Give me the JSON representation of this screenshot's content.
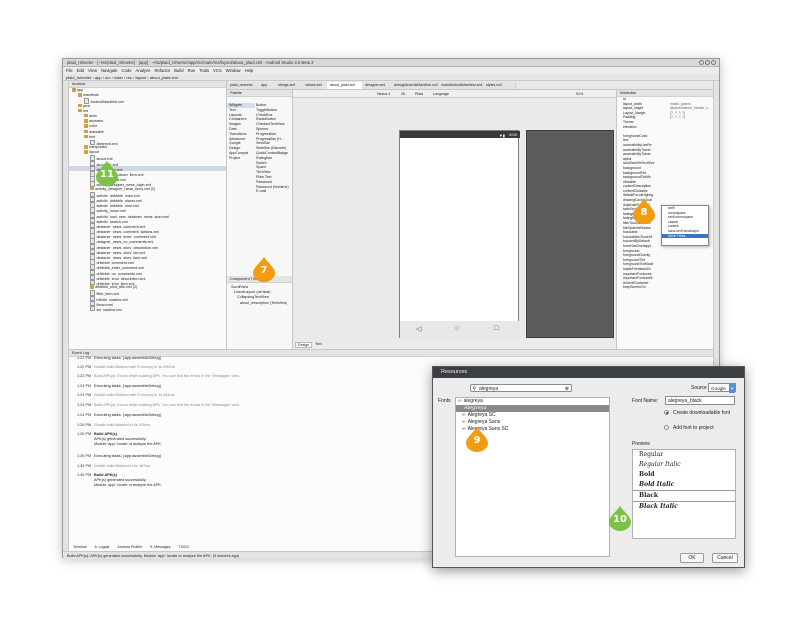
{
  "ide": {
    "title": "plaid_rsheeter - [~/ss/plaid_rsheeter] - [app] - ~/ss/plaid_rsheeter/app/src/main/res/layout/about_plaid.xml - Android Studio 3.0 Beta 2",
    "menu": [
      "File",
      "Edit",
      "View",
      "Navigate",
      "Code",
      "Analyze",
      "Refactor",
      "Build",
      "Run",
      "Tools",
      "VCS",
      "Window",
      "Help"
    ],
    "breadcrumbs": [
      "plaid_rsheeter",
      "app",
      "src",
      "main",
      "res",
      "layout",
      "about_plaid.xml"
    ],
    "project_panel_title": "Android",
    "tree": [
      {
        "label": "app",
        "depth": 0,
        "kind": "folder"
      },
      {
        "label": "manifests",
        "depth": 1,
        "kind": "folder"
      },
      {
        "label": "AndroidManifest.xml",
        "depth": 2,
        "kind": "file"
      },
      {
        "label": "java",
        "depth": 1,
        "kind": "folder"
      },
      {
        "label": "res",
        "depth": 1,
        "kind": "folder"
      },
      {
        "label": "anim",
        "depth": 2,
        "kind": "folder"
      },
      {
        "label": "animator",
        "depth": 2,
        "kind": "folder"
      },
      {
        "label": "color",
        "depth": 2,
        "kind": "folder"
      },
      {
        "label": "drawable",
        "depth": 2,
        "kind": "folder"
      },
      {
        "label": "font",
        "depth": 2,
        "kind": "folder"
      },
      {
        "label": "alegreya.xml",
        "depth": 3,
        "kind": "file"
      },
      {
        "label": "interpolator",
        "depth": 2,
        "kind": "folder"
      },
      {
        "label": "layout",
        "depth": 2,
        "kind": "folder"
      },
      {
        "label": "about.xml",
        "depth": 3,
        "kind": "file"
      },
      {
        "label": "about_lib.xml",
        "depth": 3,
        "kind": "file"
      },
      {
        "label": "about_plaid.xml",
        "depth": 3,
        "kind": "file",
        "selected": true
      },
      {
        "label": "account_dropdown_item.xml",
        "depth": 3,
        "kind": "file"
      },
      {
        "label": "activity_about.xml",
        "depth": 3,
        "kind": "file"
      },
      {
        "label": "activity_designer_news_login.xml",
        "depth": 3,
        "kind": "file"
      },
      {
        "label": "activity_designer_news_story.xml (2)",
        "depth": 3,
        "kind": "folder"
      },
      {
        "label": "activity_dribbble_login.xml",
        "depth": 3,
        "kind": "file"
      },
      {
        "label": "activity_dribbble_player.xml",
        "depth": 3,
        "kind": "file"
      },
      {
        "label": "activity_dribbble_shot.xml",
        "depth": 3,
        "kind": "file"
      },
      {
        "label": "activity_home.xml",
        "depth": 3,
        "kind": "file"
      },
      {
        "label": "activity_post_new_designer_news_story.xml",
        "depth": 3,
        "kind": "file"
      },
      {
        "label": "activity_search.xml",
        "depth": 3,
        "kind": "file"
      },
      {
        "label": "designer_news_comment.xml",
        "depth": 3,
        "kind": "file"
      },
      {
        "label": "designer_news_comment_actions.xml",
        "depth": 3,
        "kind": "file"
      },
      {
        "label": "designer_news_enter_comment.xml",
        "depth": 3,
        "kind": "file"
      },
      {
        "label": "designer_news_no_comments.xml",
        "depth": 3,
        "kind": "file"
      },
      {
        "label": "designer_news_story_description.xml",
        "depth": 3,
        "kind": "file"
      },
      {
        "label": "designer_news_story_fab.xml",
        "depth": 3,
        "kind": "file"
      },
      {
        "label": "designer_news_story_item.xml",
        "depth": 3,
        "kind": "file"
      },
      {
        "label": "dribbble_comment.xml",
        "depth": 3,
        "kind": "file"
      },
      {
        "label": "dribbble_enter_comment.xml",
        "depth": 3,
        "kind": "file"
      },
      {
        "label": "dribbble_no_comments.xml",
        "depth": 3,
        "kind": "file"
      },
      {
        "label": "dribbble_shot_description.xml",
        "depth": 3,
        "kind": "file"
      },
      {
        "label": "dribbble_shot_item.xml",
        "depth": 3,
        "kind": "file"
      },
      {
        "label": "dribbble_shot_title.xml (2)",
        "depth": 3,
        "kind": "folder"
      },
      {
        "label": "filter_item.xml",
        "depth": 3,
        "kind": "file"
      },
      {
        "label": "infinite_loading.xml",
        "depth": 3,
        "kind": "file"
      },
      {
        "label": "library.xml",
        "depth": 3,
        "kind": "file"
      },
      {
        "label": "list_loading.xml",
        "depth": 3,
        "kind": "file"
      }
    ],
    "editor_tabs": [
      "plaid_rsheeter",
      "app",
      "strings.xml",
      "values.xml",
      "about_plaid.xml",
      "designer.xml",
      "debug/AndroidManifest.xml",
      "main/AndroidManifest.xml",
      "styles.xml"
    ],
    "active_tab_index": 4,
    "palette": {
      "title": "Palette",
      "categories": [
        "Widgets",
        "Text",
        "Layouts",
        "Containers",
        "Images",
        "Date",
        "Transitions",
        "Advanced",
        "Google",
        "Design",
        "AppCompat",
        "Project"
      ],
      "selected_category_index": 0,
      "items": [
        "Button",
        "ToggleButton",
        "CheckBox",
        "RadioButton",
        "CheckedTextView",
        "Spinner",
        "ProgressBar",
        "ProgressBar (H...",
        "SeekBar",
        "SeekBar (Discrete)",
        "QuickContactBadge",
        "RatingBar",
        "Switch",
        "Space",
        "TextView",
        "Plain Text",
        "Password",
        "Password (Numeric)",
        "E-mail"
      ]
    },
    "component_tree": {
      "title": "Component Tree",
      "rows": [
        "ScrollView",
        "LinearLayout (vertical)",
        "CollapsingTextView",
        "about_description (TextView)"
      ]
    },
    "design_toolbar": {
      "device": "Nexus 4",
      "api": "26",
      "theme": "Plaid",
      "language": "Language",
      "zoom": "51%"
    },
    "phone_time": "8:00",
    "design_tabs": [
      "Design",
      "Text"
    ],
    "attributes": {
      "title": "Attributes",
      "rows": [
        {
          "name": "id",
          "value": ""
        },
        {
          "name": "layout_width",
          "value": "match_parent"
        },
        {
          "name": "layout_height",
          "value": "@dimen/about_header_h..."
        },
        {
          "name": "Layout_Margin",
          "value": "[?, ?, ?, ?]"
        },
        {
          "name": "Padding",
          "value": "[?, ?, ?, ?]"
        },
        {
          "name": "Theme",
          "value": ""
        },
        {
          "name": "elevation",
          "value": ""
        },
        {
          "name": "",
          "value": ""
        },
        {
          "name": "foregroundColor",
          "value": ""
        },
        {
          "name": "text",
          "value": ""
        },
        {
          "name": "accessibilityLiveRe",
          "value": ""
        },
        {
          "name": "accessibilityTraver",
          "value": ""
        },
        {
          "name": "accessibilityTraver",
          "value": ""
        },
        {
          "name": "alpha",
          "value": ""
        },
        {
          "name": "autoSizeMinTextSize",
          "value": ""
        },
        {
          "name": "background",
          "value": ""
        },
        {
          "name": "backgroundTint",
          "value": ""
        },
        {
          "name": "backgroundTintMo",
          "value": ""
        },
        {
          "name": "clickable",
          "value": ""
        },
        {
          "name": "contentDescription",
          "value": ""
        },
        {
          "name": "contextClickable",
          "value": ""
        },
        {
          "name": "defaultFocusHighlig",
          "value": ""
        },
        {
          "name": "drawingCacheQual",
          "value": ""
        },
        {
          "name": "duplicateParentSt",
          "value": ""
        },
        {
          "name": "fadeScrollBars",
          "value": ""
        },
        {
          "name": "fadingEdge",
          "value": ""
        },
        {
          "name": "fadingEdgeLength",
          "value": ""
        },
        {
          "name": "filterTouchesWhen",
          "value": ""
        },
        {
          "name": "fitsSystemWindow",
          "value": ""
        },
        {
          "name": "focusable",
          "value": ""
        },
        {
          "name": "focusableInTouchM",
          "value": ""
        },
        {
          "name": "focusedByDefault",
          "value": ""
        },
        {
          "name": "forceHasOverlappi",
          "value": ""
        },
        {
          "name": "foreground",
          "value": ""
        },
        {
          "name": "foregroundGravity",
          "value": ""
        },
        {
          "name": "foregroundTint",
          "value": ""
        },
        {
          "name": "foregroundTintMode",
          "value": ""
        },
        {
          "name": "hapticFeedbackEn",
          "value": ""
        },
        {
          "name": "importantForAcces",
          "value": ""
        },
        {
          "name": "importantForAutofill",
          "value": ""
        },
        {
          "name": "isScrollContainer",
          "value": ""
        },
        {
          "name": "keepScreenOn",
          "value": ""
        }
      ],
      "font_dropdown": [
        "serif",
        "monospace",
        "serif-monospace",
        "casual",
        "cursive",
        "sans-serif-smallcaps",
        "More Fonts..."
      ],
      "font_dropdown_selected_index": 6
    },
    "event_log": {
      "title": "Event Log",
      "entries": [
        {
          "time": "1:22 PM",
          "text": "Executing tasks: [:app:assembleDebug]"
        },
        {
          "time": "1:22 PM",
          "text": "Gradle build finished with 5 error(s) in 1s 590ms"
        },
        {
          "time": "1:22 PM",
          "text": "Build APK(s): Errors while building APK. You can find the errors in the 'Messages' view."
        },
        {
          "time": "1:24 PM",
          "text": "Executing tasks: [:app:assembleDebug]"
        },
        {
          "time": "1:24 PM",
          "text": "Gradle build finished with 5 error(s) in 1s 681ms"
        },
        {
          "time": "1:24 PM",
          "text": "Build APK(s): Errors while building APK. You can find the errors in the 'Messages' view."
        },
        {
          "time": "1:24 PM",
          "text": "Executing tasks: [:app:assembleDebug]"
        },
        {
          "time": "1:26 PM",
          "text": "Gradle build finished in 4s 929ms"
        },
        {
          "time": "1:26 PM",
          "text": "Build APK(s)"
        },
        {
          "time": "",
          "text": "APK(s) generated successfully."
        },
        {
          "time": "",
          "text": "Module 'app': locate or analyze the APK."
        },
        {
          "time": "1:35 PM",
          "text": "Executing tasks: [:app:assembleDebug]"
        },
        {
          "time": "1:35 PM",
          "text": "Gradle build finished in 6s 467ms"
        },
        {
          "time": "1:35 PM",
          "text": "Build APK(s)"
        },
        {
          "time": "",
          "text": "APK(s) generated successfully."
        },
        {
          "time": "",
          "text": "Module 'app': locate or analyze the APK."
        }
      ]
    },
    "bottom_tabs": [
      "Terminal",
      "6: Logcat",
      "Android Profiler",
      "0: Messages",
      "TODO"
    ],
    "status_text": "Build APK(s): APK(s) generated successfully. Module 'app': locate or analyze the APK. (3 minutes ago)"
  },
  "dialog": {
    "title": "Resources",
    "search_value": "alegreya",
    "source_label": "Source",
    "source_value": "Google Fonts",
    "fonts_label": "Fonts",
    "font_list": [
      {
        "label": "alegreya",
        "prefix": "∞",
        "kind": "header"
      },
      {
        "label": "Alegreya",
        "prefix": "",
        "kind": "item",
        "selected": true
      },
      {
        "label": "Alegreya SC",
        "prefix": "∞",
        "kind": "item"
      },
      {
        "label": "Alegreya Sans",
        "prefix": "∞",
        "kind": "item"
      },
      {
        "label": "Alegreya Sans SC",
        "prefix": "∞",
        "kind": "item"
      }
    ],
    "font_name_label": "Font Name:",
    "font_name_value": "alegreya_black",
    "radio_downloadable": "Create downloadable font",
    "radio_project": "Add font to project",
    "preview_label": "Preview",
    "preview": [
      "Regular",
      "Regular Italic",
      "Bold",
      "Bold Italic",
      "Black",
      "Black Italic"
    ],
    "preview_selected_index": 4,
    "ok_label": "OK",
    "cancel_label": "Cancel"
  },
  "callouts": [
    "7",
    "8",
    "9",
    "10",
    "11"
  ],
  "colors": {
    "orange": "#f39c12",
    "green": "#7cc243",
    "dialog_title": "#3c3f41",
    "selection": "#3b73c4"
  }
}
